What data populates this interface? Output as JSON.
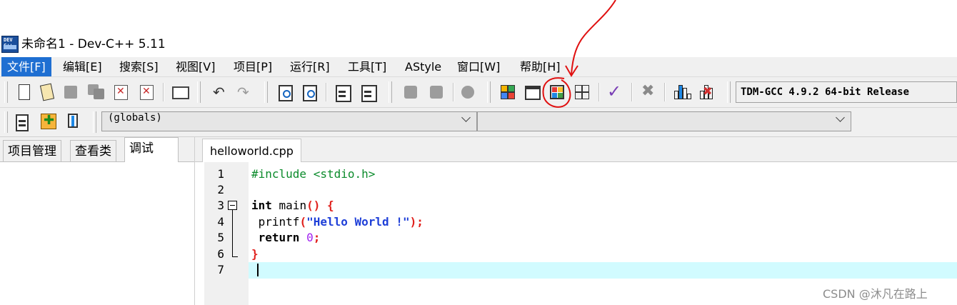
{
  "window": {
    "title": "未命名1 - Dev-C++ 5.11",
    "app_icon_text": "DEV C++"
  },
  "menu": {
    "items": [
      {
        "label": "文件[F]",
        "active": true
      },
      {
        "label": "编辑[E]"
      },
      {
        "label": "搜索[S]"
      },
      {
        "label": "视图[V]"
      },
      {
        "label": "项目[P]"
      },
      {
        "label": "运行[R]"
      },
      {
        "label": "工具[T]"
      },
      {
        "label": "AStyle"
      },
      {
        "label": "窗口[W]"
      },
      {
        "label": "帮助[H]"
      }
    ]
  },
  "toolbar": {
    "compiler": "TDM-GCC 4.9.2 64-bit Release",
    "icons": [
      "new-file-icon",
      "open-file-icon",
      "save-icon",
      "save-all-icon",
      "close-icon",
      "close-all-icon",
      "print-icon",
      "undo-icon",
      "redo-icon",
      "find-icon",
      "replace-icon",
      "indent-icon",
      "unindent-icon",
      "goto-back-icon",
      "goto-forward-icon",
      "bookmark-icon",
      "project-manager-icon",
      "fullscreen-icon",
      "toggle-layout-icon",
      "grid-view-icon",
      "check-icon",
      "delete-icon",
      "chart-icon",
      "debug-stop-icon"
    ]
  },
  "toolbar2": {
    "scope_select": "(globals)",
    "members_select": ""
  },
  "left_panel": {
    "tabs": [
      "项目管理",
      "查看类",
      "调试"
    ],
    "active_tab": "调试"
  },
  "editor": {
    "file_tab": "helloworld.cpp",
    "line_numbers": [
      "1",
      "2",
      "3",
      "4",
      "5",
      "6",
      "7"
    ],
    "lines": {
      "l1_directive": "#include <stdio.h>",
      "l3_int": "int",
      "l3_main": " main",
      "l3_parens": "()",
      "l3_brace": " {",
      "l4_printf": " printf",
      "l4_open": "(",
      "l4_string": "\"Hello World !\"",
      "l4_close": ");",
      "l5_return": " return ",
      "l5_zero": "0",
      "l5_semi": ";",
      "l6_brace": "}"
    },
    "current_line": 7
  },
  "watermark": "CSDN @沐凡在路上",
  "colors": {
    "menu_active": "#1f6fd2",
    "current_line_highlight": "#d1fbff",
    "annotation": "#e01010",
    "preprocessor": "#0b8b2b",
    "string": "#1e3fd8",
    "symbol": "#e0201c",
    "number": "#a020f0"
  }
}
